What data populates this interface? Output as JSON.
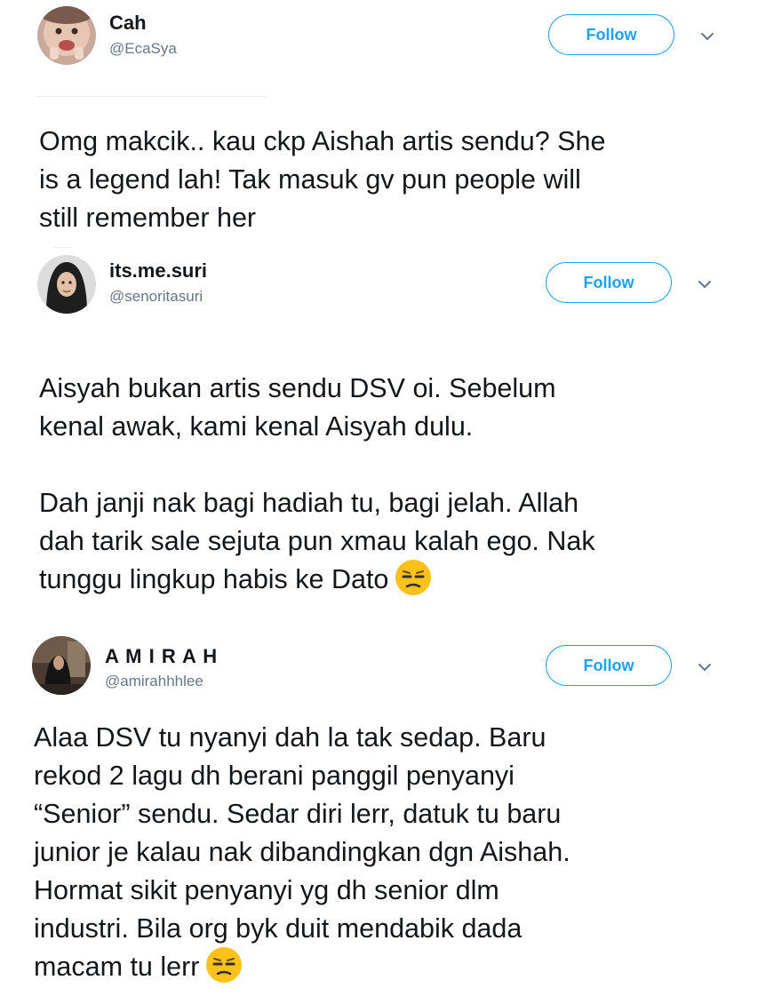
{
  "tweets": [
    {
      "author": {
        "name": "Cah",
        "handle": "@EcaSya"
      },
      "follow_label": "Follow",
      "text": "Omg makcik.. kau ckp Aishah artis sendu? She\nis a legend lah! Tak masuk gv pun people will\nstill remember her",
      "emoji": ""
    },
    {
      "author": {
        "name": "its.me.suri",
        "handle": "@senoritasuri"
      },
      "follow_label": "Follow",
      "text": "Aisyah bukan artis sendu DSV oi. Sebelum\nkenal awak, kami kenal Aisyah dulu.\n\nDah janji nak bagi hadiah tu, bagi jelah. Allah\ndah tarik sale sejuta pun xmau kalah ego. Nak\ntunggu lingkup habis ke Dato",
      "emoji": "unamused-face"
    },
    {
      "author": {
        "name": "A M I R A H",
        "handle": "@amirahhhlee"
      },
      "follow_label": "Follow",
      "text": "Alaa DSV tu nyanyi dah la tak sedap. Baru\nrekod 2 lagu dh berani panggil penyanyi\n“Senior” sendu. Sedar diri lerr, datuk tu baru\njunior je kalau nak dibandingkan dgn Aishah.\nHormat sikit penyanyi yg dh senior dlm\nindustri. Bila org byk duit mendabik dada\nmacam tu lerr",
      "emoji": "unamused-face"
    }
  ],
  "colors": {
    "accent": "#1da1f2",
    "text": "#14171a",
    "secondary_text": "#657786",
    "emoji_yellow": "#fcc21b"
  }
}
